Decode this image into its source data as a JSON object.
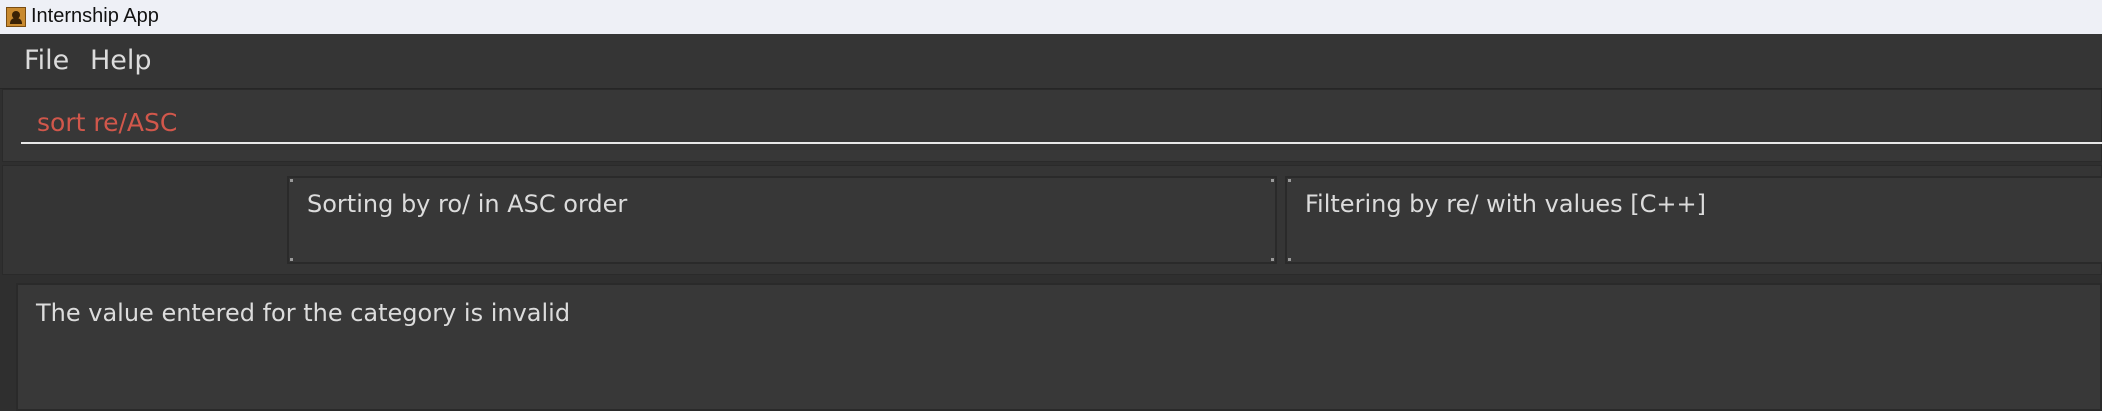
{
  "window": {
    "title": "Internship App",
    "icon": "app-icon"
  },
  "menu": {
    "items": [
      {
        "label": "File"
      },
      {
        "label": "Help"
      }
    ]
  },
  "command": {
    "value": "sort re/ASC",
    "text_color": "#d1574b"
  },
  "status": {
    "sort_text": "Sorting by ro/ in ASC order",
    "filter_text": "Filtering by re/ with values [C++]"
  },
  "result": {
    "message": "The value entered for the category is invalid"
  },
  "colors": {
    "background": "#2f2f2f",
    "panel": "#373737",
    "text": "#dcdcdc",
    "titlebar": "#eef0f6"
  }
}
